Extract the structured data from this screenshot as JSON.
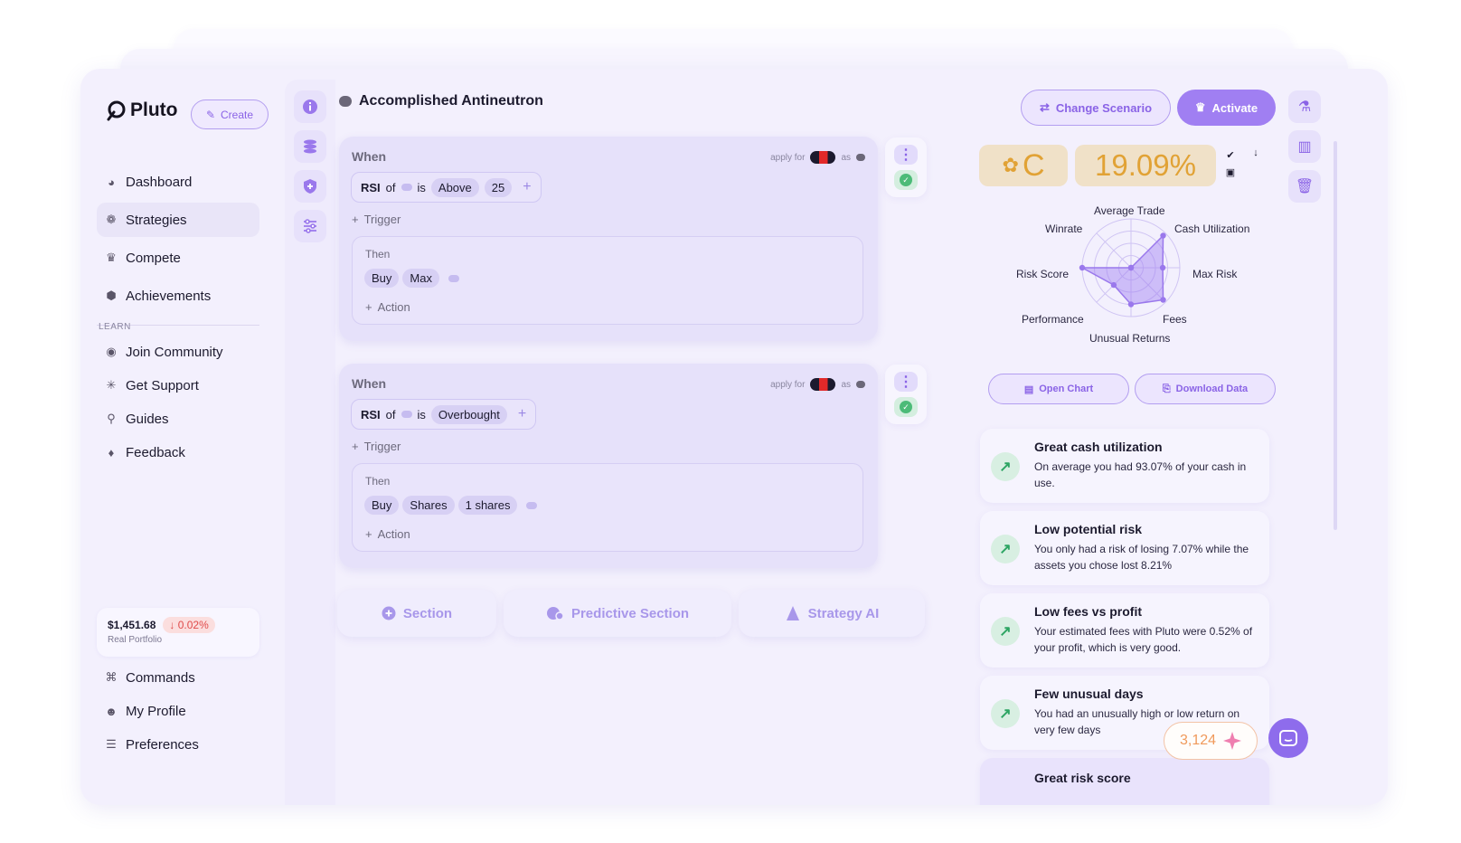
{
  "brand": {
    "name": "Pluto"
  },
  "sidebar": {
    "create_label": "Create",
    "items": [
      {
        "label": "Dashboard",
        "icon": "pie-chart-icon"
      },
      {
        "label": "Strategies",
        "icon": "brain-icon",
        "active": true
      },
      {
        "label": "Compete",
        "icon": "trophy-icon"
      },
      {
        "label": "Achievements",
        "icon": "medal-icon"
      }
    ],
    "learn_label": "LEARN",
    "learn_items": [
      {
        "label": "Join Community",
        "icon": "discord-icon"
      },
      {
        "label": "Get Support",
        "icon": "support-icon"
      },
      {
        "label": "Guides",
        "icon": "walker-icon"
      },
      {
        "label": "Feedback",
        "icon": "bulb-icon"
      }
    ],
    "portfolio": {
      "value": "$1,451.68",
      "change": "0.02%",
      "label": "Real Portfolio"
    },
    "bottom_items": [
      {
        "label": "Commands",
        "icon": "command-icon"
      },
      {
        "label": "My Profile",
        "icon": "profile-icon"
      },
      {
        "label": "Preferences",
        "icon": "sliders-icon"
      }
    ]
  },
  "strategy": {
    "title": "Accomplished Antineutron",
    "blocks": [
      {
        "when_label": "When",
        "apply_for": "apply for",
        "as_label": "as",
        "condition": {
          "indicator": "RSI",
          "of": "of",
          "is": "is",
          "comparator": "Above",
          "value": "25"
        },
        "trigger_label": "Trigger",
        "then_label": "Then",
        "actions": [
          "Buy",
          "Max"
        ],
        "action_label": "Action"
      },
      {
        "when_label": "When",
        "apply_for": "apply for",
        "as_label": "as",
        "condition": {
          "indicator": "RSI",
          "of": "of",
          "is": "is",
          "comparator": "Overbought"
        },
        "trigger_label": "Trigger",
        "then_label": "Then",
        "actions": [
          "Buy",
          "Shares",
          "1 shares"
        ],
        "action_label": "Action"
      }
    ],
    "add_buttons": [
      "Section",
      "Predictive Section",
      "Strategy AI"
    ]
  },
  "header": {
    "change_scenario": "Change Scenario",
    "activate": "Activate"
  },
  "score": {
    "grade": "C",
    "percent": "19.09%",
    "radar": {
      "labels": [
        "Average Trade",
        "Cash Utilization",
        "Max Risk",
        "Fees",
        "Unusual Returns",
        "Performance",
        "Risk Score",
        "Winrate"
      ],
      "values": [
        0.0,
        0.93,
        0.65,
        0.93,
        0.75,
        0.5,
        1.0,
        0.0
      ]
    },
    "open_chart": "Open Chart",
    "download_data": "Download Data"
  },
  "insights": [
    {
      "title": "Great cash utilization",
      "text": "On average you had 93.07% of your cash in use."
    },
    {
      "title": "Low potential risk",
      "text": "You only had a risk of losing 7.07% while the assets you chose lost 8.21%"
    },
    {
      "title": "Low fees vs profit",
      "text": "Your estimated fees with Pluto were 0.52% of your profit, which is very good."
    },
    {
      "title": "Few unusual days",
      "text": "You had an unusually high or low return on very few days"
    },
    {
      "title": "Great risk score",
      "text": ""
    }
  ],
  "credits": "3,124",
  "colors": {
    "accent": "#a07ff2",
    "grade": "#e1a235",
    "positive": "#4cbb78",
    "negative": "#e04b4b"
  }
}
